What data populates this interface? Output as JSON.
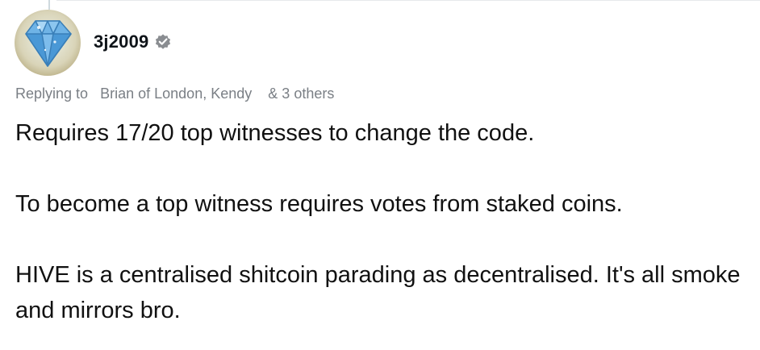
{
  "tweet": {
    "author": {
      "username": "3j2009",
      "verified_icon": "verified-badge-icon",
      "avatar_icon": "diamond-avatar"
    },
    "replying": {
      "prefix": "Replying to",
      "recipients": "Brian of London, Kendy",
      "others": "& 3 others"
    },
    "paragraphs": [
      "Requires 17/20 top witnesses to change the code.",
      "To become a top witness requires votes from staked coins.",
      "HIVE is a centralised shitcoin parading as decentralised. It's all smoke and mirrors bro."
    ]
  },
  "colors": {
    "text": "#111111",
    "muted": "#7a7f85",
    "badge": "#8a8d91"
  }
}
